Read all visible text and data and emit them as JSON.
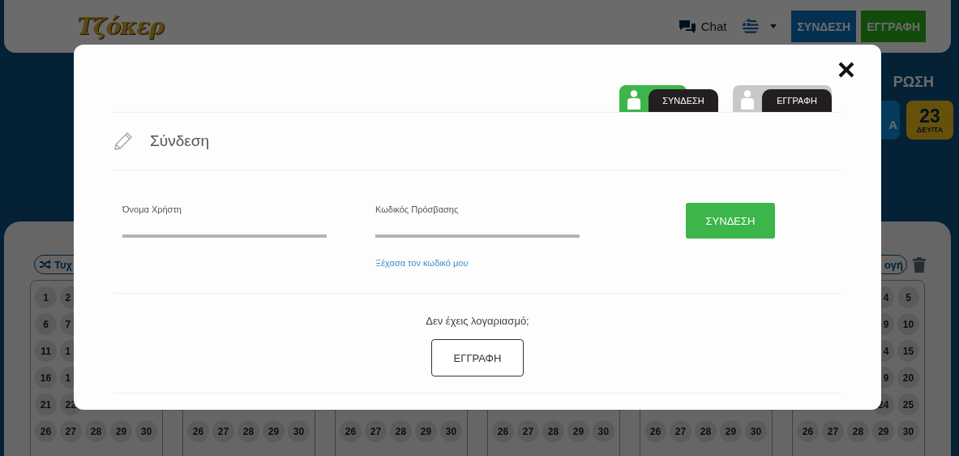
{
  "header": {
    "logo": "Τζόκερ",
    "chat": "Chat",
    "login_button": "ΣΥΝΔΕΣΗ",
    "register_button": "ΕΓΓΡΑΦΗ"
  },
  "draw_banner": {
    "title": "ΡΩΣΗ",
    "partial_box": "Α",
    "countdown": {
      "value": "23",
      "unit": "ΔΕΥ/ΤΑ"
    }
  },
  "ticket": {
    "quick_pick_button": "Τυχ",
    "right_button": "ογή",
    "panels": [
      {
        "rows": [
          [
            "1",
            "2",
            null,
            null,
            null
          ],
          [
            "6",
            "7",
            null,
            null,
            null
          ],
          [
            "11",
            "1",
            null,
            null,
            null
          ],
          [
            "16",
            "1",
            null,
            null,
            null
          ],
          [
            "21",
            "22",
            null,
            null,
            null
          ],
          [
            "26",
            "27",
            "28",
            "29",
            "30"
          ]
        ]
      },
      {
        "rows": [
          [
            null,
            null,
            null,
            null,
            null
          ],
          [
            null,
            null,
            null,
            null,
            null
          ],
          [
            null,
            null,
            null,
            null,
            null
          ],
          [
            null,
            null,
            null,
            null,
            null
          ],
          [
            null,
            null,
            null,
            null,
            null
          ],
          [
            "26",
            "27",
            "28",
            "29",
            "30"
          ]
        ]
      },
      {
        "rows": [
          [
            null,
            null,
            null,
            null,
            null
          ],
          [
            null,
            null,
            null,
            null,
            null
          ],
          [
            null,
            null,
            null,
            null,
            null
          ],
          [
            null,
            null,
            null,
            null,
            null
          ],
          [
            null,
            null,
            null,
            null,
            null
          ],
          [
            "26",
            "27",
            "28",
            "29",
            "30"
          ]
        ]
      },
      {
        "rows": [
          [
            null,
            null,
            null,
            null,
            null
          ],
          [
            null,
            null,
            null,
            null,
            null
          ],
          [
            null,
            null,
            null,
            null,
            null
          ],
          [
            null,
            null,
            null,
            null,
            null
          ],
          [
            null,
            null,
            null,
            null,
            null
          ],
          [
            "26",
            "27",
            "28",
            "29",
            "30"
          ]
        ]
      },
      {
        "rows": [
          [
            null,
            null,
            null,
            null,
            null
          ],
          [
            null,
            null,
            null,
            null,
            null
          ],
          [
            null,
            null,
            null,
            null,
            null
          ],
          [
            null,
            null,
            null,
            null,
            null
          ],
          [
            null,
            null,
            null,
            null,
            null
          ],
          [
            "26",
            "27",
            "28",
            "29",
            "30"
          ]
        ]
      },
      {
        "rows": [
          [
            null,
            null,
            null,
            "4",
            "5"
          ],
          [
            null,
            null,
            null,
            "9",
            "10"
          ],
          [
            null,
            null,
            null,
            "4",
            "15"
          ],
          [
            null,
            null,
            null,
            "9",
            "20"
          ],
          [
            null,
            null,
            null,
            "24",
            "25"
          ],
          [
            "26",
            "27",
            "28",
            "29",
            "30"
          ]
        ]
      }
    ]
  },
  "modal": {
    "tabs": [
      {
        "label": "ΣΥΝΔΕΣΗ",
        "selected": true
      },
      {
        "label": "ΕΓΓΡΑΦΗ",
        "selected": false
      }
    ],
    "heading": "Σύνδεση",
    "fields": [
      {
        "label": "Όνομα Χρήστη"
      },
      {
        "label": "Κωδικός Πρόσβασης"
      }
    ],
    "forgot_link": "Ξέχασα τον κωδικό μου",
    "submit_button": "ΣΥΝΔΕΣΗ",
    "no_account_text": "Δεν έχεις λογαριασμό;",
    "register_button": "ΕΓΓΡΑΦΗ"
  }
}
